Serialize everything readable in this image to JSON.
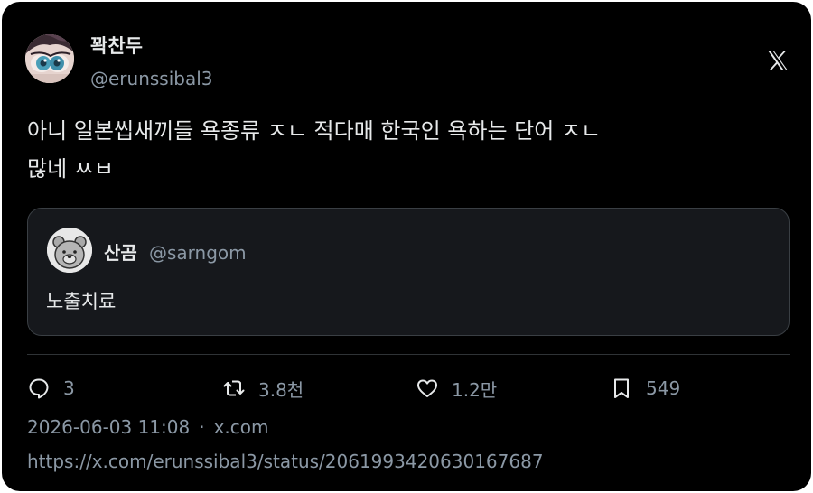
{
  "author": {
    "name": "꽉찬두",
    "handle": "@erunssibal3"
  },
  "tweet": {
    "text": "아니 일본씹새끼들 욕종류 ㅈㄴ 적다매 한국인 욕하는 단어 ㅈㄴ\n많네 ㅆㅂ"
  },
  "quote": {
    "name": "산곰",
    "handle": "@sarngom",
    "text": "노출치료"
  },
  "actions": {
    "replies": "3",
    "retweets": "3.8천",
    "likes": "1.2만",
    "bookmarks": "549"
  },
  "meta": {
    "timestamp": "2026-06-03 11:08",
    "separator": "·",
    "source": "x.com",
    "url": "https://x.com/erunssibal3/status/2061993420630167687"
  },
  "icons": {
    "platform_logo": "x-logo-icon",
    "reply": "speech-bubble-icon",
    "retweet": "retweet-arrows-icon",
    "like": "heart-icon",
    "bookmark": "bookmark-icon"
  },
  "colors": {
    "background": "#000000",
    "primary_text": "#e7e9ea",
    "secondary_text": "#8b98a5",
    "quote_background": "#16181c",
    "border": "#3a3f44"
  }
}
